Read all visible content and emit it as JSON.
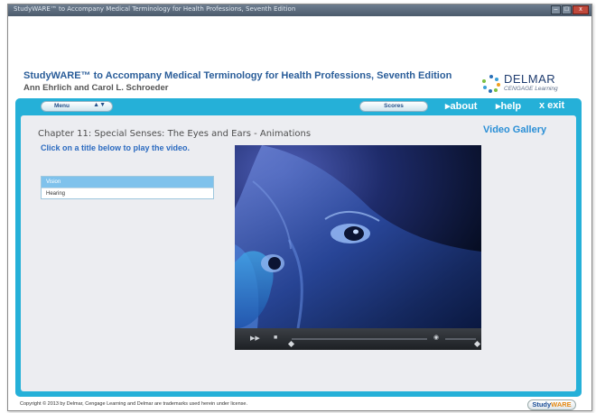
{
  "window": {
    "title": "StudyWARE™ to Accompany Medical Terminology for Health Professions, Seventh Edition",
    "buttons": {
      "minimize": "–",
      "maximize": "□",
      "close": "x"
    }
  },
  "header": {
    "title": "StudyWARE™ to Accompany Medical Terminology for Health Professions, Seventh Edition",
    "authors": "Ann Ehrlich and Carol L. Schroeder",
    "logo": {
      "name": "DELMAR",
      "sub": "CENGAGE Learning"
    }
  },
  "nav": {
    "menu_label": "Menu",
    "menu_arrows": "▲▼",
    "scores_label": "Scores",
    "about_label": "▸about",
    "help_label": "▸help",
    "exit_label": "x exit"
  },
  "main": {
    "chapter_title": "Chapter 11: Special Senses: The Eyes and Ears - Animations",
    "instruction": "Click on a title below to play the video.",
    "gallery_title": "Video Gallery",
    "videos": [
      {
        "label": "Vision",
        "selected": true
      },
      {
        "label": "Hearing",
        "selected": false
      }
    ]
  },
  "player": {
    "play_icon": "play-pause-icon",
    "rewind_glyph": "▶▶",
    "stop_glyph": "■",
    "volume_glyph": "◉",
    "progress": 0.0
  },
  "footer": {
    "copyright": "Copyright © 2013 by Delmar, Cengage Learning and Delmar are trademarks used herein under license.",
    "badge_study": "Study",
    "badge_ware": "WARE"
  },
  "colors": {
    "panel": "#25b0d8",
    "content_bg": "#ecedf1",
    "title_blue": "#2a5d99",
    "link_blue": "#2c6bc0"
  }
}
